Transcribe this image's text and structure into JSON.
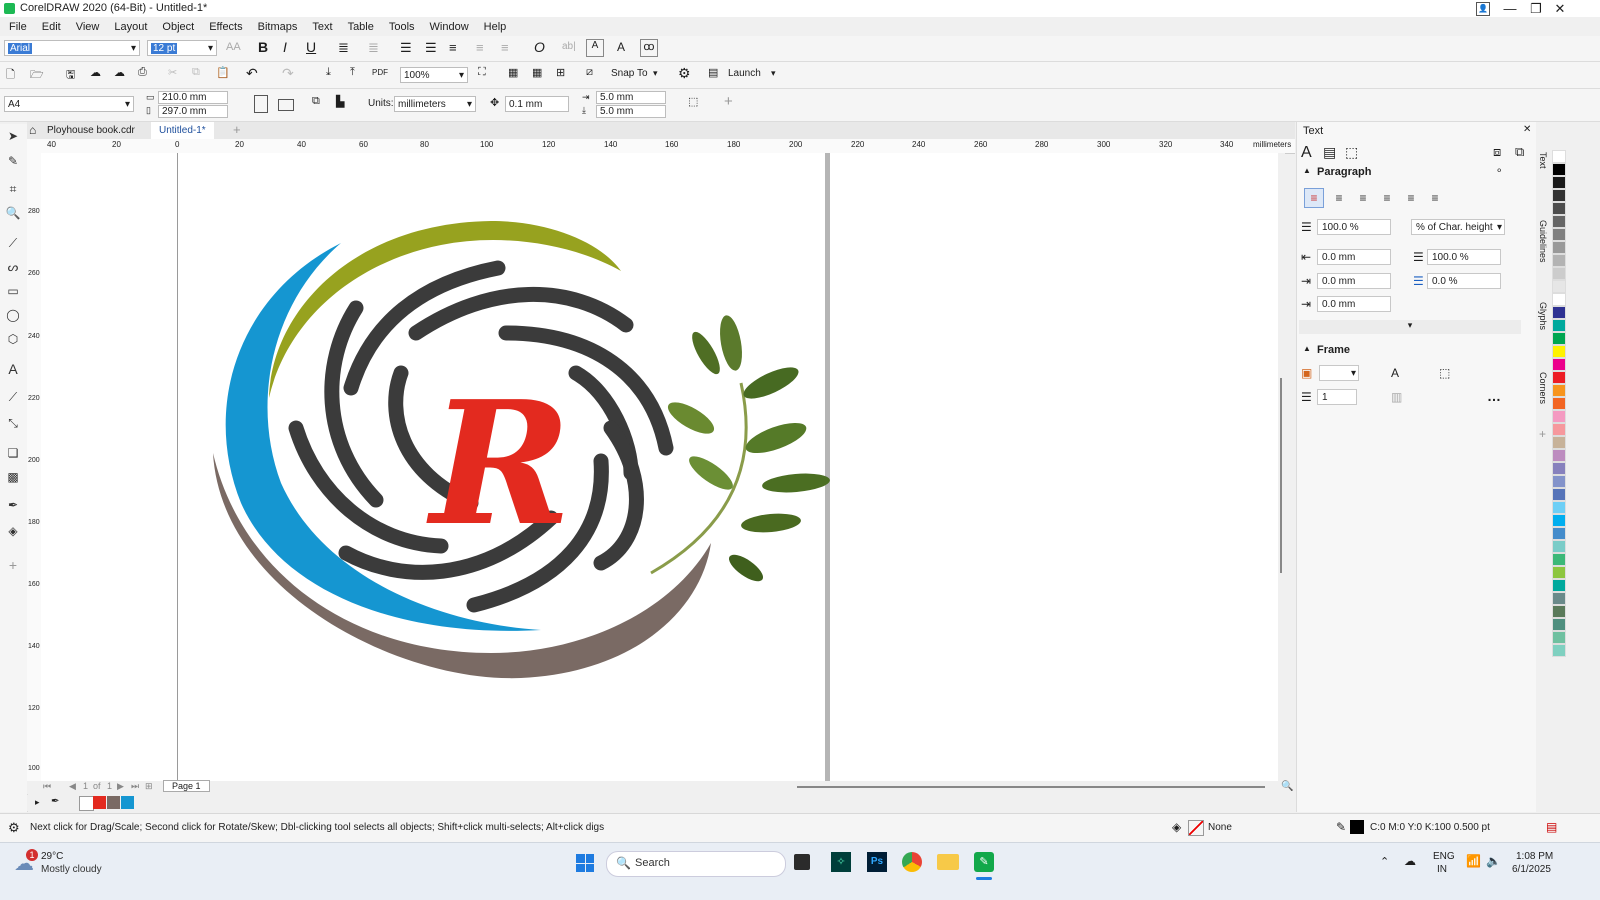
{
  "window": {
    "title": "CorelDRAW 2020 (64-Bit) - Untitled-1*",
    "controls": [
      "—",
      "❐",
      "✕"
    ]
  },
  "menu": [
    "File",
    "Edit",
    "View",
    "Layout",
    "Object",
    "Effects",
    "Bitmaps",
    "Text",
    "Table",
    "Tools",
    "Window",
    "Help"
  ],
  "text_bar": {
    "font": "Arial",
    "size": "12 pt"
  },
  "standard_bar": {
    "zoom": "100%",
    "snap": "Snap To",
    "launch": "Launch"
  },
  "property_bar": {
    "page_size": "A4",
    "width": "210.0 mm",
    "height": "297.0 mm",
    "units_label": "Units:",
    "units": "millimeters",
    "nudge": "0.1 mm",
    "dup_x": "5.0 mm",
    "dup_y": "5.0 mm"
  },
  "tabs": [
    {
      "label": "Ployhouse book.cdr"
    },
    {
      "label": "Untitled-1*"
    }
  ],
  "ruler": {
    "h_ticks": [
      "40",
      "20",
      "0",
      "20",
      "40",
      "60",
      "80",
      "100",
      "120",
      "140",
      "160",
      "180",
      "200",
      "220",
      "240",
      "260",
      "280",
      "300",
      "320",
      "340"
    ],
    "unit": "millimeters",
    "v_ticks": [
      "280",
      "260",
      "240",
      "220",
      "200",
      "180",
      "160",
      "140",
      "120",
      "100"
    ]
  },
  "panel": {
    "title": "Text",
    "paragraph": {
      "title": "Paragraph",
      "line_spacing": "100.0 %",
      "line_spacing_unit": "% of Char. height",
      "left_indent": "0.0 mm",
      "char_spacing": "100.0 %",
      "first_indent": "0.0 mm",
      "word_spacing": "0.0 %",
      "right_indent": "0.0 mm"
    },
    "frame": {
      "title": "Frame",
      "columns": "1"
    },
    "side_tabs": [
      "Text",
      "Guidelines",
      "Glyphs",
      "Corners"
    ]
  },
  "palette_colors": [
    "#ffffff",
    "#000000",
    "#1a1a1a",
    "#333333",
    "#4d4d4d",
    "#666666",
    "#808080",
    "#999999",
    "#b3b3b3",
    "#cccccc",
    "#e6e6e6",
    "#ffffff",
    "#2e3192",
    "#00a99d",
    "#00a651",
    "#fff200",
    "#ec008c",
    "#ed1c24",
    "#f7941d",
    "#f26522",
    "#f49ac1",
    "#f6989d",
    "#c7b299",
    "#bd8cbf",
    "#8781bd",
    "#8393ca",
    "#5674b9",
    "#6dcff6",
    "#00aeef",
    "#448ccb",
    "#7accc8",
    "#3cb878",
    "#8dc63f",
    "#00a99d",
    "#6a8a8a",
    "#5a7a5a",
    "#4f8f7f",
    "#6fc0a0",
    "#7fd0c0"
  ],
  "page_nav": {
    "current": "1",
    "of": "of",
    "total": "1",
    "page_label": "Page 1"
  },
  "doc_palette": [
    "#e32a1f",
    "#7a6a64",
    "#1596d1"
  ],
  "status": {
    "hint": "Next click for Drag/Scale; Second click for Rotate/Skew; Dbl-clicking tool selects all objects; Shift+click multi-selects; Alt+click digs",
    "fill": "None",
    "outline": "C:0 M:0 Y:0 K:100  0.500 pt"
  },
  "taskbar": {
    "weather_temp": "29°C",
    "weather_desc": "Mostly cloudy",
    "badge": "1",
    "search": "Search",
    "lang": "ENG",
    "region": "IN",
    "time": "1:08 PM",
    "date": "6/1/2025"
  }
}
